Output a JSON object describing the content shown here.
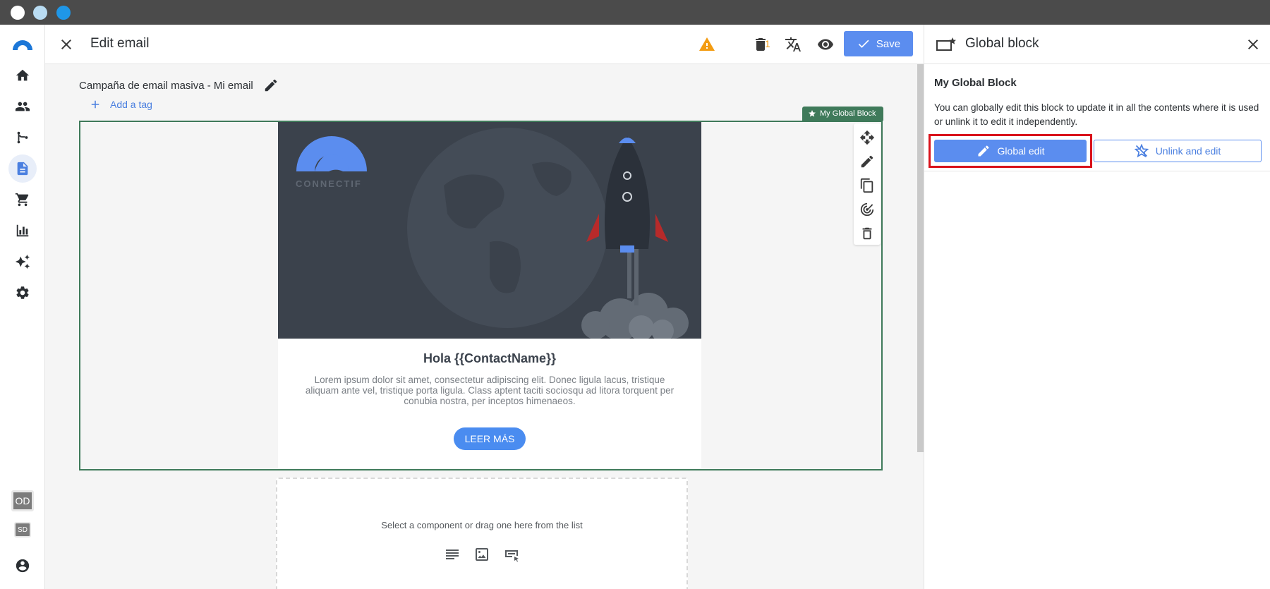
{
  "header": {
    "title": "Edit email",
    "warning_count": "1",
    "save_label": "Save"
  },
  "canvas": {
    "campaign_name": "Campaña de email masiva - Mi email",
    "add_tag_label": "Add a tag",
    "global_block_tag": "My Global Block",
    "logo_text": "CONNECTIF",
    "greeting": "Hola {{ContactName}}",
    "lorem": "Lorem ipsum dolor sit amet, consectetur adipiscing elit. Donec ligula lacus, tristique aliquam ante vel, tristique porta ligula. Class aptent taciti sociosqu ad litora torquent per conubia nostra, per inceptos himenaeos.",
    "cta_label": "LEER MÁS",
    "dropzone_hint": "Select a component or drag one here from the list"
  },
  "rail": {
    "badges": [
      "OD",
      "SD"
    ]
  },
  "panel": {
    "title": "Global block",
    "block_name": "My Global Block",
    "description": "You can globally edit this block to update it in all the contents where it is used or unlink it to edit it independently.",
    "global_edit_label": "Global edit",
    "unlink_label": "Unlink and edit"
  },
  "colors": {
    "accent": "#5b8def",
    "block_border": "#3f7a5a",
    "highlight": "#d9121b",
    "warning": "#f39c12"
  }
}
